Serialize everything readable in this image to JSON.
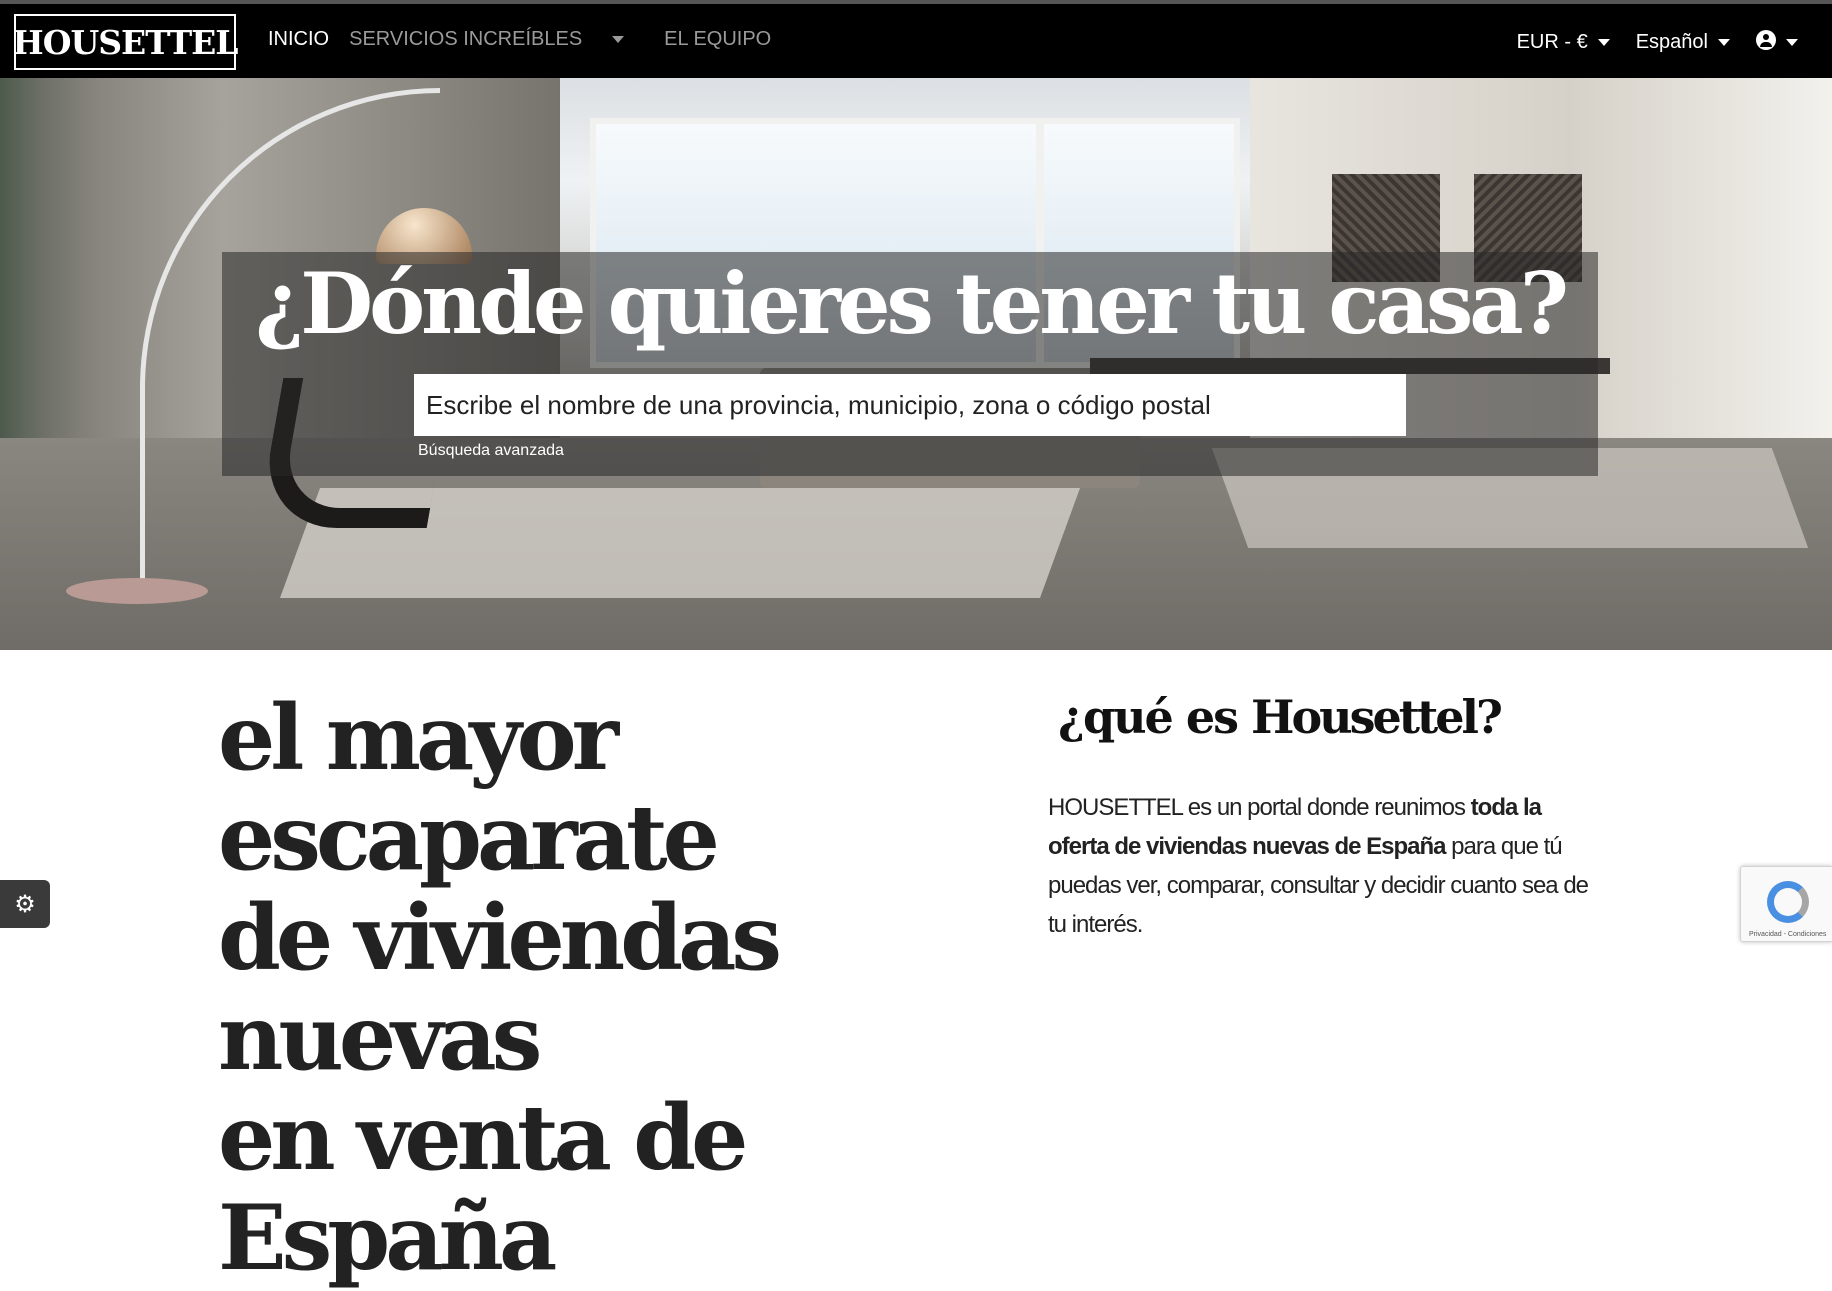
{
  "brand": {
    "logo_text": "HOUSETTEL"
  },
  "nav": {
    "items": [
      {
        "label": "INICIO"
      },
      {
        "label": "SERVICIOS INCREÍBLES"
      },
      {
        "label": "EL EQUIPO"
      }
    ],
    "currency": "EUR - €",
    "language": "Español"
  },
  "hero": {
    "title": "¿Dónde quieres tener tu casa?",
    "search_placeholder": "Escribe el nombre de una provincia, municipio, zona o código postal",
    "advanced_search": "Búsqueda avanzada"
  },
  "main": {
    "headline_lines": [
      "el mayor escaparate",
      "de viviendas nuevas",
      "en venta de España"
    ],
    "question_prefix": "¿qué es ",
    "question_brand": "Housettel?",
    "description": {
      "part1": "HOUSETTEL es un portal donde reunimos ",
      "bold1": "toda la oferta de viviendas nuevas de España",
      "part2": " para que tú puedas ver, comparar, consultar y decidir cuanto sea de tu interés."
    }
  },
  "widgets": {
    "settings_icon": "gear-icon",
    "recaptcha_text": "Privacidad - Condiciones"
  }
}
